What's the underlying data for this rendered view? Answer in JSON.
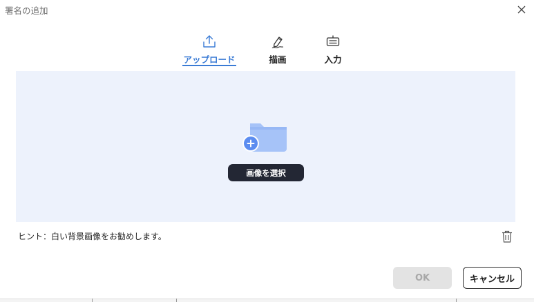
{
  "dialog": {
    "title": "署名の追加",
    "close_icon": "close-icon"
  },
  "tabs": [
    {
      "label": "アップロード",
      "icon": "upload-icon",
      "active": true
    },
    {
      "label": "描画",
      "icon": "pen-draw-icon",
      "active": false
    },
    {
      "label": "入力",
      "icon": "keyboard-icon",
      "active": false
    }
  ],
  "upload_area": {
    "icon": "folder-add-icon",
    "select_button_label": "画像を選択"
  },
  "hint": "ヒント：白い背景画像をお勧めします。",
  "footer": {
    "ok_label": "OK",
    "cancel_label": "キャンセル",
    "delete_icon": "trash-icon"
  },
  "colors": {
    "accent": "#3a7bd5",
    "drop_area_bg": "#edf2fc",
    "dark_button": "#232734",
    "folder_light": "#a6c3f8",
    "folder_dark": "#5c8df0"
  }
}
